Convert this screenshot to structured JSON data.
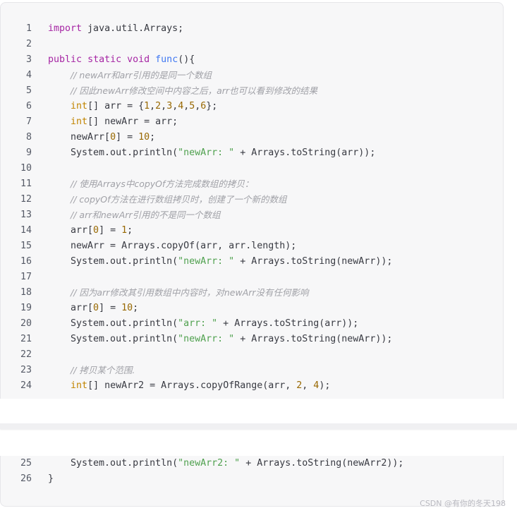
{
  "code": {
    "lines_top": [
      {
        "n": "1",
        "segs": [
          {
            "t": "import",
            "c": "kw"
          },
          {
            "t": " java.util.Arrays;",
            "c": ""
          }
        ]
      },
      {
        "n": "2",
        "segs": []
      },
      {
        "n": "3",
        "segs": [
          {
            "t": "public",
            "c": "kw"
          },
          {
            "t": " ",
            "c": ""
          },
          {
            "t": "static",
            "c": "kw"
          },
          {
            "t": " ",
            "c": ""
          },
          {
            "t": "void",
            "c": "kw"
          },
          {
            "t": " ",
            "c": ""
          },
          {
            "t": "func",
            "c": "fn"
          },
          {
            "t": "(){",
            "c": ""
          }
        ]
      },
      {
        "n": "4",
        "segs": [
          {
            "t": "    ",
            "c": ""
          },
          {
            "t": "// newArr和arr引用的是同一个数组",
            "c": "com"
          }
        ]
      },
      {
        "n": "5",
        "segs": [
          {
            "t": "    ",
            "c": ""
          },
          {
            "t": "// 因此newArr修改空间中内容之后，arr也可以看到修改的结果",
            "c": "com"
          }
        ]
      },
      {
        "n": "6",
        "segs": [
          {
            "t": "    ",
            "c": ""
          },
          {
            "t": "int",
            "c": "ty"
          },
          {
            "t": "[] arr = {",
            "c": ""
          },
          {
            "t": "1",
            "c": "num"
          },
          {
            "t": ",",
            "c": ""
          },
          {
            "t": "2",
            "c": "num"
          },
          {
            "t": ",",
            "c": ""
          },
          {
            "t": "3",
            "c": "num"
          },
          {
            "t": ",",
            "c": ""
          },
          {
            "t": "4",
            "c": "num"
          },
          {
            "t": ",",
            "c": ""
          },
          {
            "t": "5",
            "c": "num"
          },
          {
            "t": ",",
            "c": ""
          },
          {
            "t": "6",
            "c": "num"
          },
          {
            "t": "};",
            "c": ""
          }
        ]
      },
      {
        "n": "7",
        "segs": [
          {
            "t": "    ",
            "c": ""
          },
          {
            "t": "int",
            "c": "ty"
          },
          {
            "t": "[] newArr = arr;",
            "c": ""
          }
        ]
      },
      {
        "n": "8",
        "segs": [
          {
            "t": "    newArr[",
            "c": ""
          },
          {
            "t": "0",
            "c": "num"
          },
          {
            "t": "] = ",
            "c": ""
          },
          {
            "t": "10",
            "c": "num"
          },
          {
            "t": ";",
            "c": ""
          }
        ]
      },
      {
        "n": "9",
        "segs": [
          {
            "t": "    System.out.println(",
            "c": ""
          },
          {
            "t": "\"newArr: \"",
            "c": "str"
          },
          {
            "t": " + Arrays.toString(arr));",
            "c": ""
          }
        ]
      },
      {
        "n": "10",
        "segs": []
      },
      {
        "n": "11",
        "segs": [
          {
            "t": "    ",
            "c": ""
          },
          {
            "t": "// 使用Arrays中copyOf方法完成数组的拷贝：",
            "c": "com"
          }
        ]
      },
      {
        "n": "12",
        "segs": [
          {
            "t": "    ",
            "c": ""
          },
          {
            "t": "// copyOf方法在进行数组拷贝时，创建了一个新的数组",
            "c": "com"
          }
        ]
      },
      {
        "n": "13",
        "segs": [
          {
            "t": "    ",
            "c": ""
          },
          {
            "t": "// arr和newArr引用的不是同一个数组",
            "c": "com"
          }
        ]
      },
      {
        "n": "14",
        "segs": [
          {
            "t": "    arr[",
            "c": ""
          },
          {
            "t": "0",
            "c": "num"
          },
          {
            "t": "] = ",
            "c": ""
          },
          {
            "t": "1",
            "c": "num"
          },
          {
            "t": ";",
            "c": ""
          }
        ]
      },
      {
        "n": "15",
        "segs": [
          {
            "t": "    newArr = Arrays.copyOf(arr, arr.length);",
            "c": ""
          }
        ]
      },
      {
        "n": "16",
        "segs": [
          {
            "t": "    System.out.println(",
            "c": ""
          },
          {
            "t": "\"newArr: \"",
            "c": "str"
          },
          {
            "t": " + Arrays.toString(newArr));",
            "c": ""
          }
        ]
      },
      {
        "n": "17",
        "segs": []
      },
      {
        "n": "18",
        "segs": [
          {
            "t": "    ",
            "c": ""
          },
          {
            "t": "// 因为arr修改其引用数组中内容时，对newArr没有任何影响",
            "c": "com"
          }
        ]
      },
      {
        "n": "19",
        "segs": [
          {
            "t": "    arr[",
            "c": ""
          },
          {
            "t": "0",
            "c": "num"
          },
          {
            "t": "] = ",
            "c": ""
          },
          {
            "t": "10",
            "c": "num"
          },
          {
            "t": ";",
            "c": ""
          }
        ]
      },
      {
        "n": "20",
        "segs": [
          {
            "t": "    System.out.println(",
            "c": ""
          },
          {
            "t": "\"arr: \"",
            "c": "str"
          },
          {
            "t": " + Arrays.toString(arr));",
            "c": ""
          }
        ]
      },
      {
        "n": "21",
        "segs": [
          {
            "t": "    System.out.println(",
            "c": ""
          },
          {
            "t": "\"newArr: \"",
            "c": "str"
          },
          {
            "t": " + Arrays.toString(newArr));",
            "c": ""
          }
        ]
      },
      {
        "n": "22",
        "segs": []
      },
      {
        "n": "23",
        "segs": [
          {
            "t": "    ",
            "c": ""
          },
          {
            "t": "// 拷贝某个范围.",
            "c": "com"
          }
        ]
      },
      {
        "n": "24",
        "segs": [
          {
            "t": "    ",
            "c": ""
          },
          {
            "t": "int",
            "c": "ty"
          },
          {
            "t": "[] newArr2 = Arrays.copyOfRange(arr, ",
            "c": ""
          },
          {
            "t": "2",
            "c": "num"
          },
          {
            "t": ", ",
            "c": ""
          },
          {
            "t": "4",
            "c": "num"
          },
          {
            "t": ");",
            "c": ""
          }
        ]
      }
    ],
    "lines_bottom": [
      {
        "n": "25",
        "segs": [
          {
            "t": "    System.out.println(",
            "c": ""
          },
          {
            "t": "\"newArr2: \"",
            "c": "str"
          },
          {
            "t": " + Arrays.toString(newArr2));",
            "c": ""
          }
        ]
      },
      {
        "n": "26",
        "segs": [
          {
            "t": "}",
            "c": ""
          }
        ]
      }
    ]
  },
  "watermark": "CSDN @有你的冬天198",
  "colors": {
    "keyword": "#a626a4",
    "type": "#c18401",
    "function": "#4078f2",
    "number": "#986801",
    "string": "#50a14f",
    "comment": "#a0a1a7",
    "background": "#f7f7f8"
  }
}
